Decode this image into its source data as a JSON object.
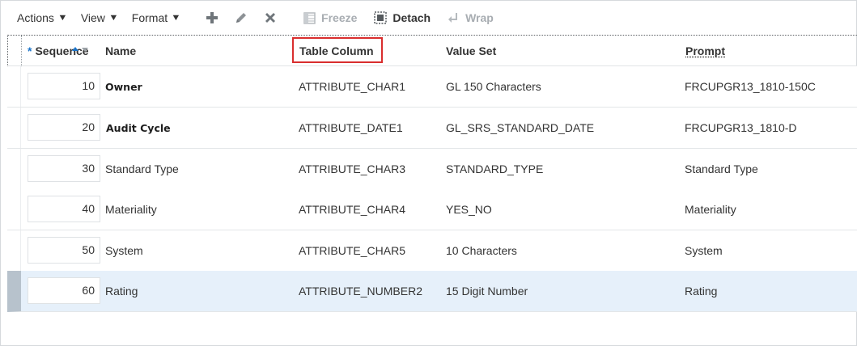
{
  "toolbar": {
    "actions_label": "Actions",
    "view_label": "View",
    "format_label": "Format",
    "freeze_label": "Freeze",
    "detach_label": "Detach",
    "wrap_label": "Wrap",
    "icons": [
      "add-icon",
      "edit-icon",
      "delete-icon",
      "freeze-icon",
      "detach-icon",
      "wrap-icon"
    ]
  },
  "table": {
    "columns": {
      "sequence": "Sequence",
      "required_marker": "*",
      "name": "Name",
      "table_column": "Table Column",
      "value_set": "Value Set",
      "prompt": "Prompt"
    },
    "rows": [
      {
        "sequence": "10",
        "name": "Owner",
        "table_column": "ATTRIBUTE_CHAR1",
        "value_set": "GL 150 Characters",
        "prompt": "FRCUPGR13_1810-150C"
      },
      {
        "sequence": "20",
        "name": "Audit Cycle",
        "table_column": "ATTRIBUTE_DATE1",
        "value_set": "GL_SRS_STANDARD_DATE",
        "prompt": "FRCUPGR13_1810-D"
      },
      {
        "sequence": "30",
        "name": "Standard Type",
        "table_column": "ATTRIBUTE_CHAR3",
        "value_set": "STANDARD_TYPE",
        "prompt": "Standard Type"
      },
      {
        "sequence": "40",
        "name": "Materiality",
        "table_column": "ATTRIBUTE_CHAR4",
        "value_set": "YES_NO",
        "prompt": "Materiality"
      },
      {
        "sequence": "50",
        "name": "System",
        "table_column": "ATTRIBUTE_CHAR5",
        "value_set": "10 Characters",
        "prompt": "System"
      },
      {
        "sequence": "60",
        "name": "Rating",
        "table_column": "ATTRIBUTE_NUMBER2",
        "value_set": "15 Digit Number",
        "prompt": "Rating"
      }
    ]
  },
  "colors": {
    "accent": "#1a73c9",
    "highlight_box": "#d92e2e",
    "selected_row": "#e6f0fa"
  }
}
